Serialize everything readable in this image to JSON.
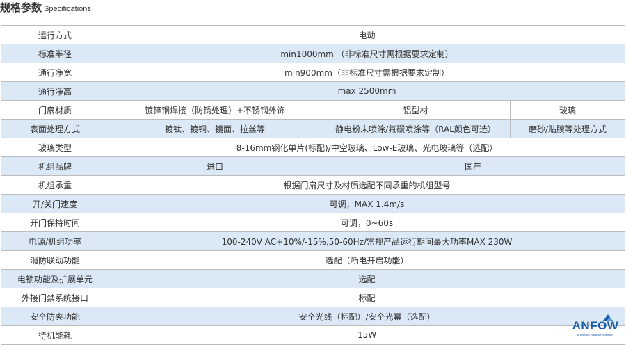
{
  "heading": {
    "title_zh": "规格参数",
    "title_en": "Specifications"
  },
  "rows": [
    {
      "label": "运行方式",
      "value": "电动"
    },
    {
      "label": "标准半径",
      "value": "min1000mm （非标准尺寸需根据要求定制）"
    },
    {
      "label": "通行净宽",
      "value": "min900mm（非标准尺寸需根据要求定制）"
    },
    {
      "label": "通行净高",
      "value": "max 2500mm"
    },
    {
      "label": "门扇材质",
      "values": [
        "镀锌钢焊接（防锈处理）+不锈钢外饰",
        "铝型材",
        "玻璃"
      ]
    },
    {
      "label": "表面处理方式",
      "values": [
        "镀钛、镀铜、镜面、拉丝等",
        "静电粉末喷涂/氟碳喷涂等（RAL颜色可选）",
        "磨砂/贴膜等处理方式"
      ]
    },
    {
      "label": "玻璃类型",
      "value": "8-16mm钢化单片(标配)/中空玻璃、Low-E玻璃、光电玻璃等（选配）"
    },
    {
      "label": "机组品牌",
      "values": [
        "进口",
        "国产"
      ]
    },
    {
      "label": "机组承重",
      "value": "根据门扇尺寸及材质选配不同承重的机组型号"
    },
    {
      "label": "开/关门速度",
      "value": "可调，MAX 1.4m/s"
    },
    {
      "label": "开门保持时间",
      "value": "可调，0~60s"
    },
    {
      "label": "电源/机组功率",
      "value": "100-240V AC+10%/-15%,50-60Hz/常规产品运行期间最大功率MAX 230W"
    },
    {
      "label": "消防联动功能",
      "value": "选配（断电开启功能）"
    },
    {
      "label": "电锁功能及扩展单元",
      "value": "选配"
    },
    {
      "label": "外接门禁系统接口",
      "value": "标配"
    },
    {
      "label": "安全防夹功能",
      "value": "安全光线（标配）/安全光幕（选配）"
    },
    {
      "label": "待机能耗",
      "value": "15W"
    }
  ],
  "logo": {
    "name": "ANFOW",
    "tagline": "Automatic Entrance Solutions"
  },
  "colors": {
    "stripe": "#dbe8f5",
    "border": "#bcbcbc",
    "brand": "#1b5ca8"
  }
}
